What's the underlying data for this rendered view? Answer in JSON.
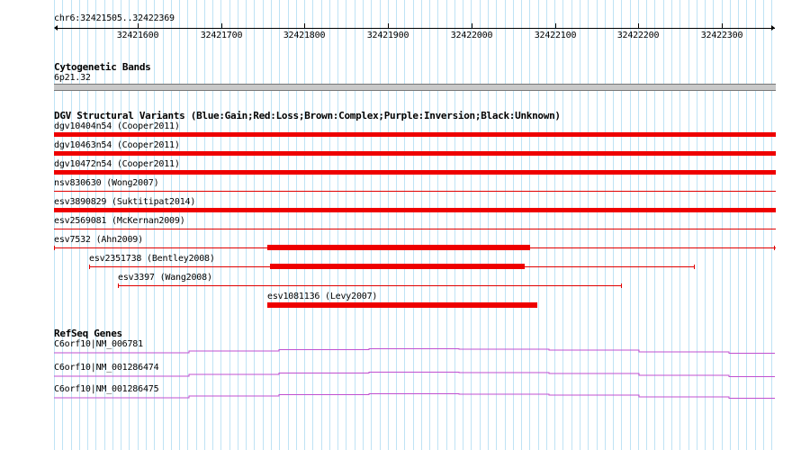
{
  "coordinate_label": "chr6:32421505..32422369",
  "ruler_ticks": [
    "32421600",
    "32421700",
    "32421800",
    "32421900",
    "32422000",
    "32422100",
    "32422200",
    "32422300"
  ],
  "cyto": {
    "title": "Cytogenetic Bands",
    "band": "6p21.32"
  },
  "dgv": {
    "title": "DGV Structural Variants (Blue:Gain;Red:Loss;Brown:Complex;Purple:Inversion;Black:Unknown)",
    "loss_color": "#ee0000",
    "variants": [
      {
        "label": "dgv10404n54 (Cooper2011)"
      },
      {
        "label": "dgv10463n54 (Cooper2011)"
      },
      {
        "label": "dgv10472n54 (Cooper2011)"
      },
      {
        "label": "nsv830630 (Wong2007)"
      },
      {
        "label": "esv3890829 (Suktitipat2014)"
      },
      {
        "label": "esv2569081 (McKernan2009)"
      },
      {
        "label": "esv7532 (Ahn2009)"
      },
      {
        "label": "esv2351738 (Bentley2008)"
      },
      {
        "label": "esv3397 (Wang2008)"
      },
      {
        "label": "esv1081136 (Levy2007)"
      }
    ]
  },
  "refseq": {
    "title": "RefSeq Genes",
    "line_color": "#c050d0",
    "genes": [
      {
        "label": "C6orf10|NM_006781"
      },
      {
        "label": "C6orf10|NM_001286474"
      },
      {
        "label": "C6orf10|NM_001286475"
      }
    ]
  }
}
